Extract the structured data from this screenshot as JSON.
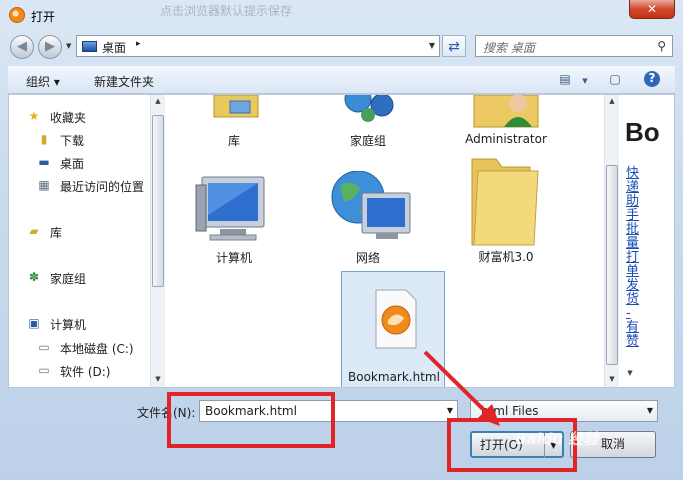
{
  "window": {
    "title": "打开",
    "ghost_title": "点击浏览器默认提示保存",
    "close_glyph": "✕"
  },
  "address": {
    "location": "桌面",
    "arrow": "▸",
    "search_placeholder": "搜索 桌面"
  },
  "toolbar": {
    "organize": "组织 ▾",
    "new_folder": "新建文件夹"
  },
  "nav": {
    "favorites": "收藏夹",
    "downloads": "下载",
    "desktop": "桌面",
    "recent": "最近访问的位置",
    "libraries": "库",
    "homegroup": "家庭组",
    "computer": "计算机",
    "local_disk": "本地磁盘 (C:)",
    "software_disk": "软件 (D:)"
  },
  "files": [
    {
      "name": "库"
    },
    {
      "name": "家庭组"
    },
    {
      "name": "Administrator"
    },
    {
      "name": "计算机"
    },
    {
      "name": "网络"
    },
    {
      "name": "财富机3.0"
    },
    {
      "name": "Bookmark.html"
    }
  ],
  "preview": {
    "title": "Bo",
    "link_text": "快递助手批量打单发货 - 有赞"
  },
  "bottom": {
    "filename_label": "文件名(N):",
    "filename_value": "Bookmark.html",
    "filetype_value": "html Files",
    "open_button": "打开(O)",
    "cancel_button": "取消"
  },
  "watermark": "Baidu 经验"
}
